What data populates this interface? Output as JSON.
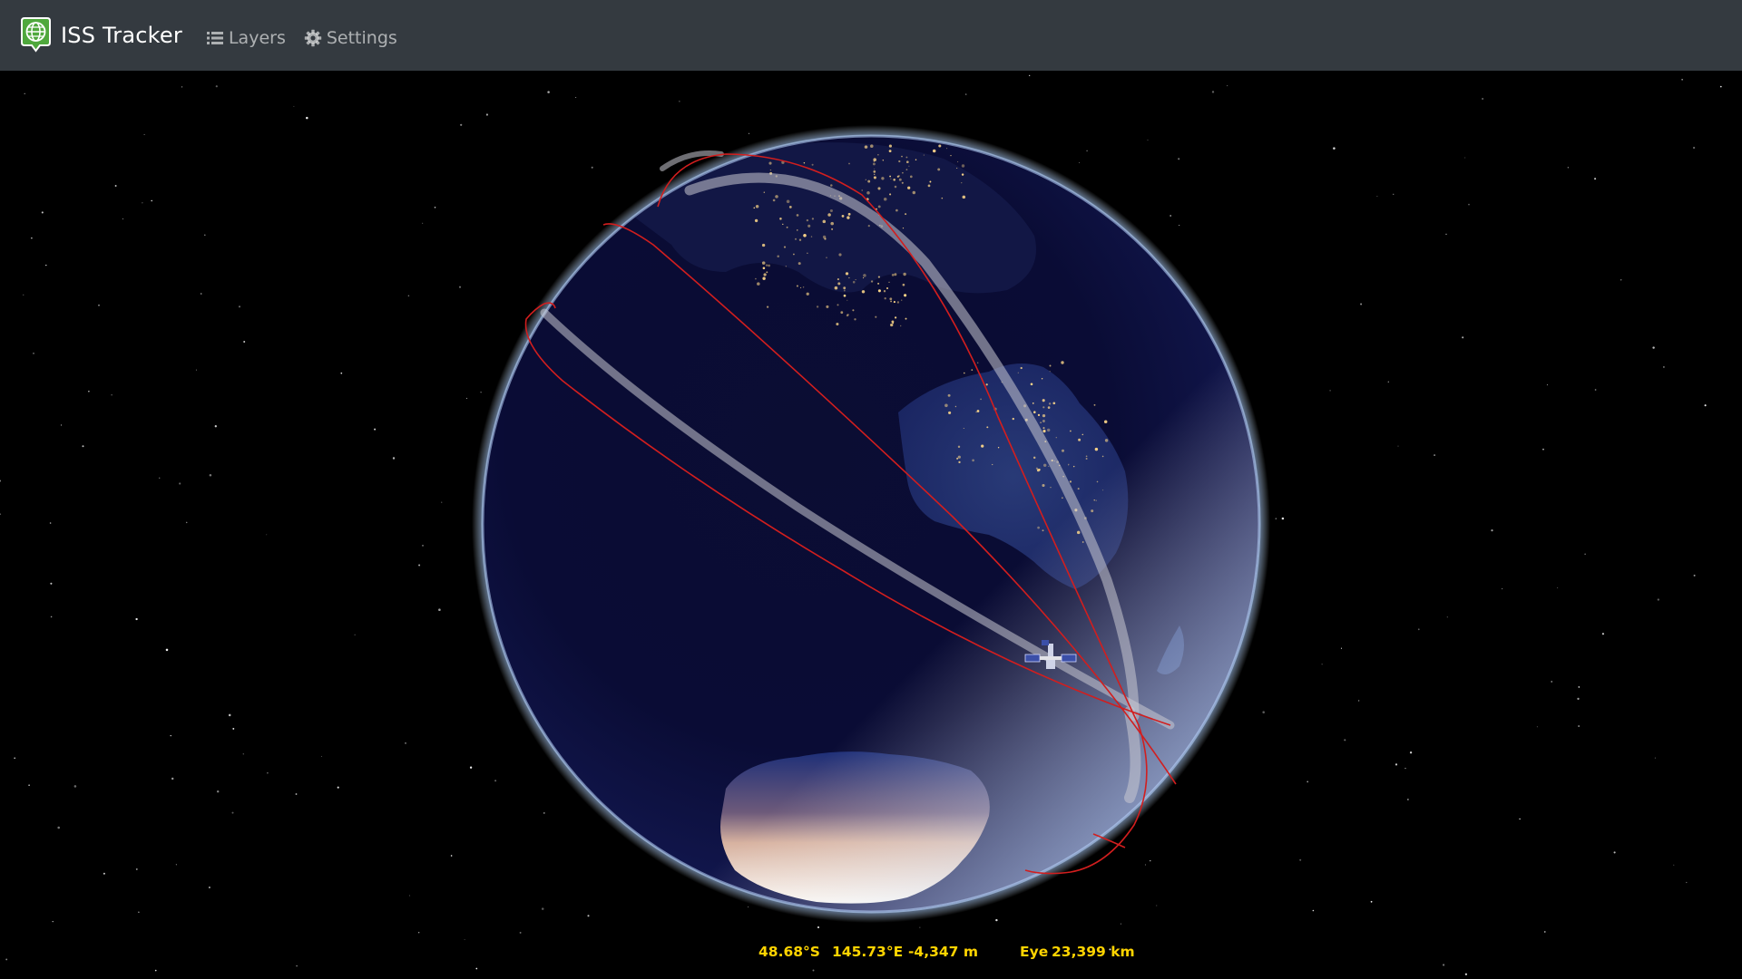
{
  "navbar": {
    "title": "ISS Tracker",
    "items": [
      {
        "label": "Layers",
        "icon": "list-icon"
      },
      {
        "label": "Settings",
        "icon": "gear-icon"
      }
    ],
    "logo_icon": "globe-marker-icon"
  },
  "viewer": {
    "background": "#000000",
    "globe": "night-earth",
    "satellite_icon": "iss-icon",
    "orbit_color": "#d21e1e"
  },
  "status": {
    "latitude": "48.68°S",
    "longitude": "145.73°E",
    "elevation": "-4,347 m",
    "eye_label": "Eye",
    "eye_value": "23,399 km",
    "text_color": "#ffd400"
  }
}
